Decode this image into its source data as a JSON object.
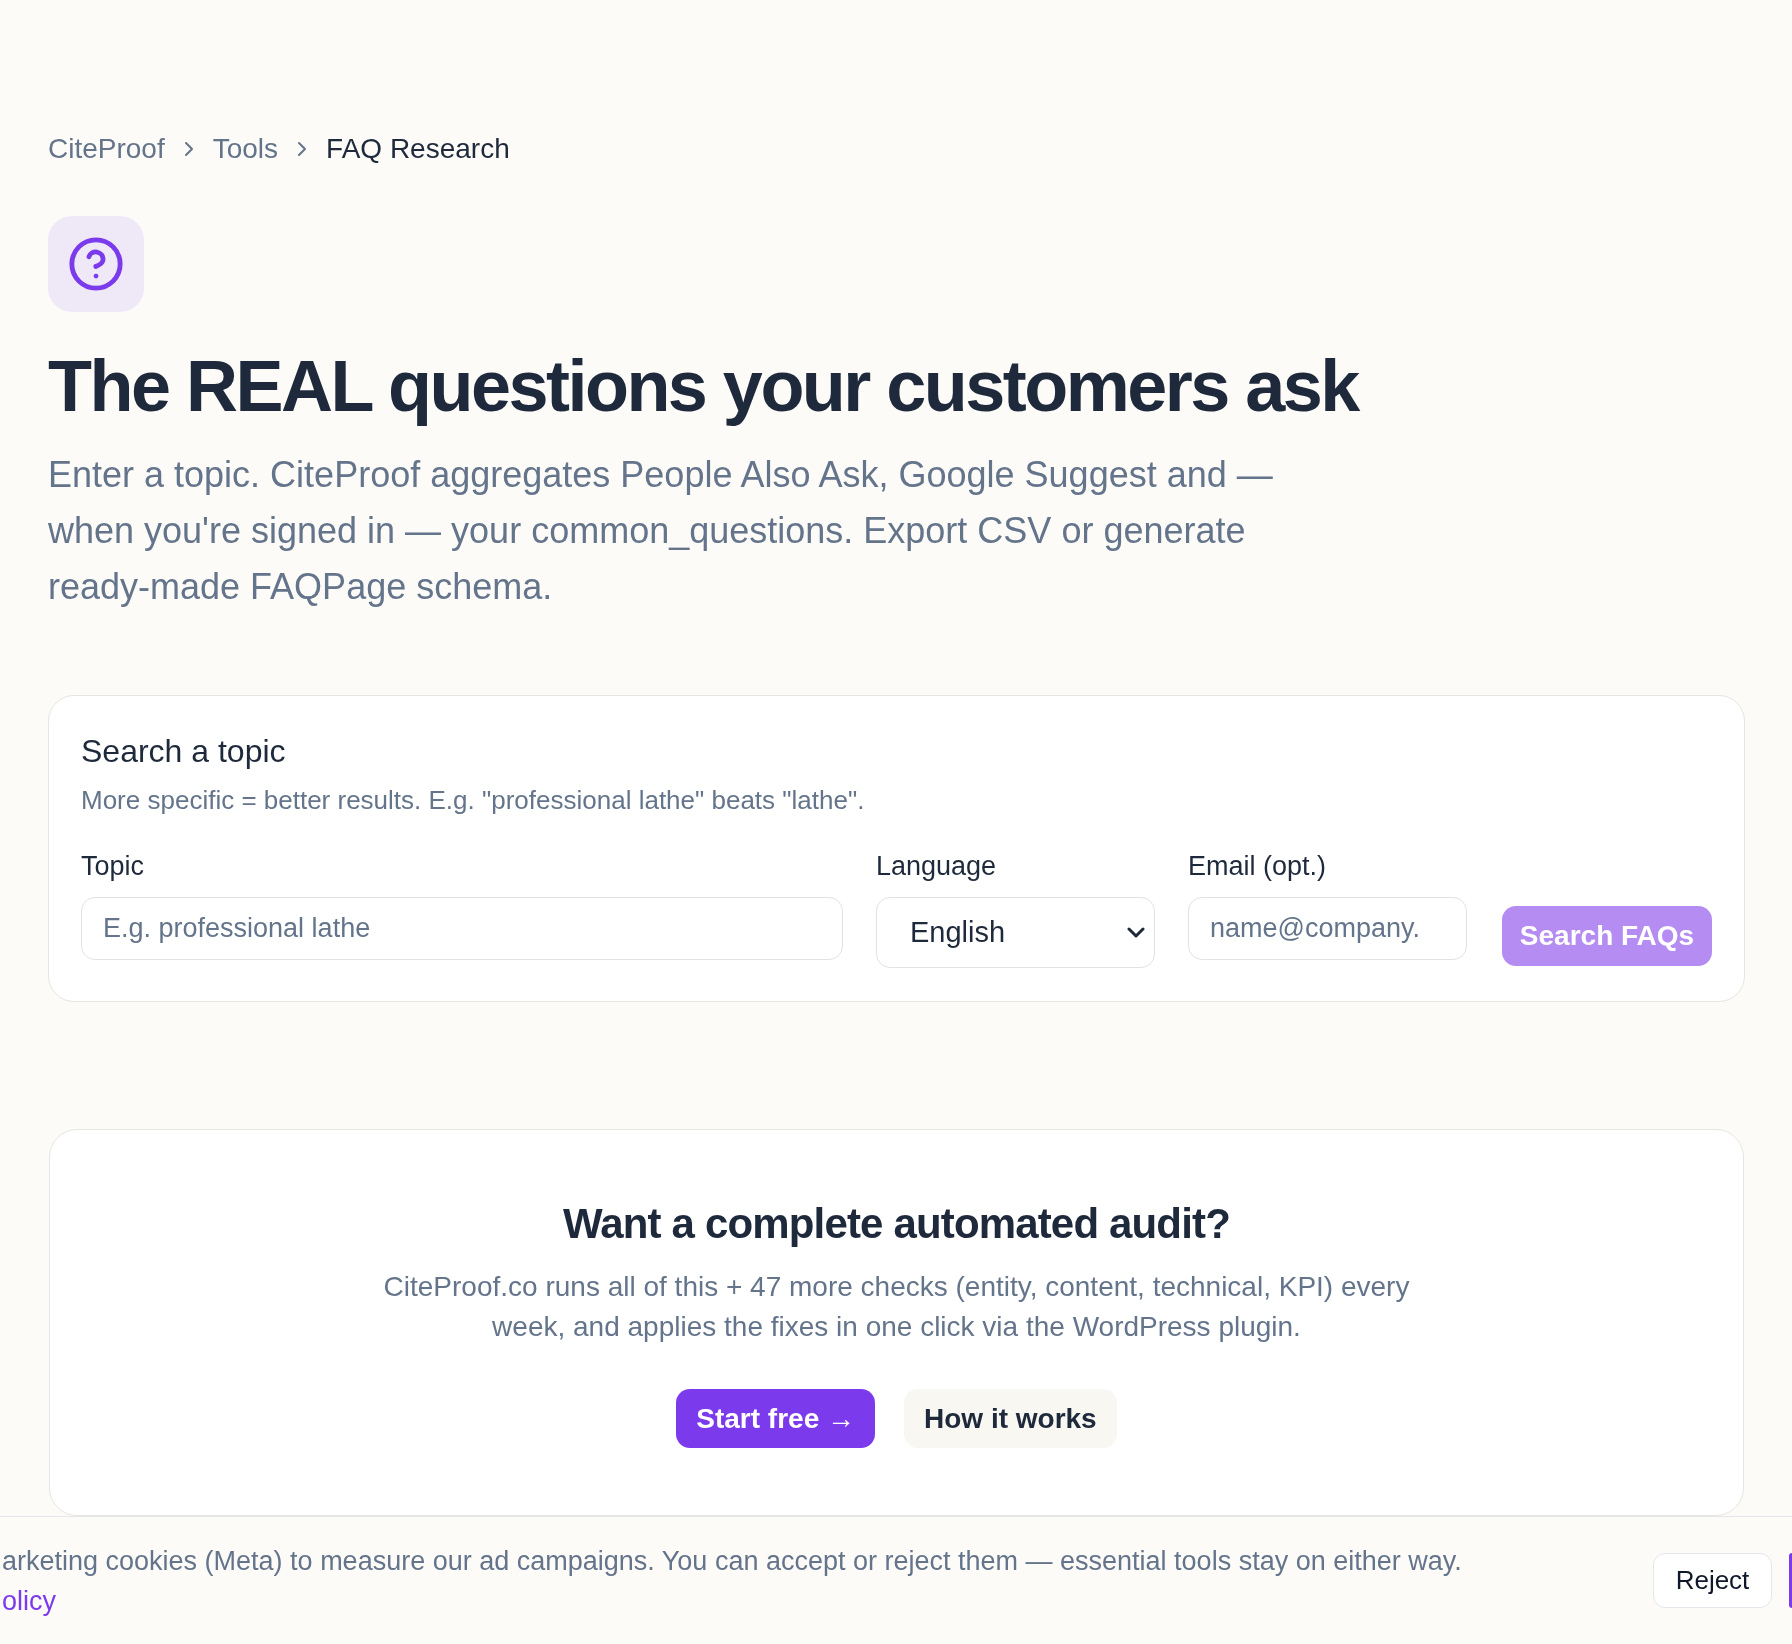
{
  "breadcrumb": [
    {
      "label": "CiteProof",
      "current": false
    },
    {
      "label": "Tools",
      "current": false
    },
    {
      "label": "FAQ Research",
      "current": true
    }
  ],
  "hero": {
    "title": "The REAL questions your customers ask",
    "description": "Enter a topic. CiteProof aggregates People Also Ask, Google Suggest and — when you're signed in — your common_questions. Export CSV or generate ready-made FAQPage schema."
  },
  "search_form": {
    "title": "Search a topic",
    "hint": "More specific = better results. E.g. \"professional lathe\" beats \"lathe\".",
    "fields": [
      {
        "kind": "text",
        "label": "Topic",
        "placeholder": "E.g. professional lathe"
      },
      {
        "kind": "select",
        "label": "Language",
        "value": "English"
      },
      {
        "kind": "email",
        "label": "Email (opt.)",
        "placeholder": "name@company."
      }
    ],
    "submit": {
      "label": "Search FAQs",
      "disabled": true
    }
  },
  "cta": {
    "title": "Want a complete automated audit?",
    "description": "CiteProof.co runs all of this + 47 more checks (entity, content, technical, KPI) every week, and applies the fixes in one click via the WordPress plugin.",
    "buttons": [
      {
        "kind": "primary",
        "label": "Start free →"
      },
      {
        "kind": "secondary",
        "label": "How it works"
      }
    ]
  },
  "cookie_banner": {
    "text": "arketing cookies (Meta) to measure our ad campaigns. You can accept or reject them — essential tools stay on either way.",
    "link": "olicy",
    "buttons": [
      {
        "kind": "secondary",
        "label": "Reject"
      },
      {
        "kind": "primary"
      }
    ]
  }
}
